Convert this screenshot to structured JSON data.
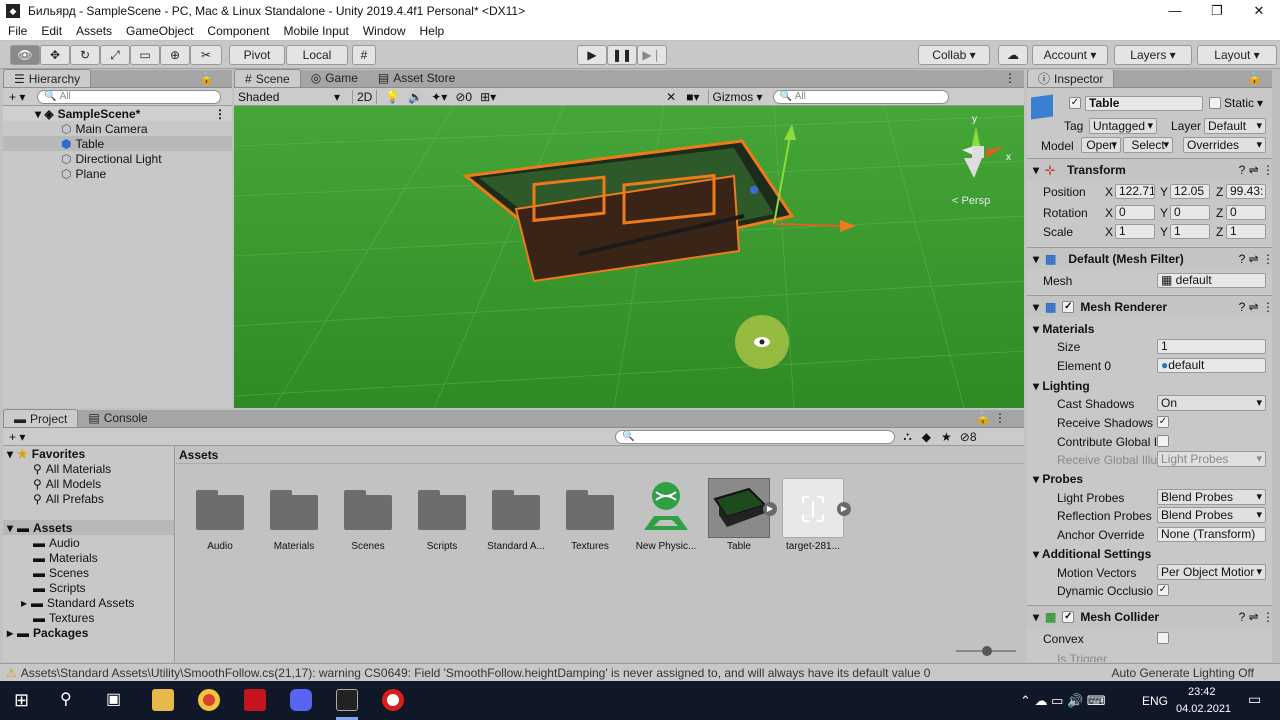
{
  "window": {
    "title": "Бильярд - SampleScene - PC, Mac & Linux Standalone - Unity 2019.4.4f1 Personal* <DX11>"
  },
  "menu": [
    "File",
    "Edit",
    "Assets",
    "GameObject",
    "Component",
    "Mobile Input",
    "Window",
    "Help"
  ],
  "toolbar": {
    "pivot": "Pivot",
    "local": "Local",
    "collab": "Collab",
    "account": "Account",
    "layers": "Layers",
    "layout": "Layout"
  },
  "hierarchy": {
    "tab": "Hierarchy",
    "search_placeholder": "All",
    "scene": "SampleScene*",
    "items": [
      "Main Camera",
      "Table",
      "Directional Light",
      "Plane"
    ]
  },
  "scene": {
    "tabs": [
      "Scene",
      "Game",
      "Asset Store"
    ],
    "shading": "Shaded",
    "mode2d": "2D",
    "hidden_count": "0",
    "gizmos": "Gizmos",
    "search_placeholder": "All",
    "persp": "< Persp",
    "axis_y": "y",
    "axis_x": "x"
  },
  "inspector": {
    "tab": "Inspector",
    "object_name": "Table",
    "static_label": "Static",
    "tag_label": "Tag",
    "tag_value": "Untagged",
    "layer_label": "Layer",
    "layer_value": "Default",
    "model_label": "Model",
    "open": "Open",
    "select": "Select",
    "overrides": "Overrides",
    "transform": {
      "title": "Transform",
      "position": "Position",
      "rotation": "Rotation",
      "scale": "Scale",
      "pos": [
        "122.71",
        "12.05",
        "99.43:"
      ],
      "rot": [
        "0",
        "0",
        "0"
      ],
      "scl": [
        "1",
        "1",
        "1"
      ],
      "axes": [
        "X",
        "Y",
        "Z"
      ]
    },
    "mesh_filter": {
      "title": "Default (Mesh Filter)",
      "mesh_label": "Mesh",
      "mesh_value": "default"
    },
    "mesh_renderer": {
      "title": "Mesh Renderer",
      "materials": "Materials",
      "size_label": "Size",
      "size_value": "1",
      "element0_label": "Element 0",
      "element0_value": "default",
      "lighting": "Lighting",
      "cast_shadows": "Cast Shadows",
      "cast_shadows_value": "On",
      "receive_shadows": "Receive Shadows",
      "contribute_gi": "Contribute Global I",
      "receive_gi": "Receive Global Illu",
      "receive_gi_value": "Light Probes",
      "probes": "Probes",
      "light_probes": "Light Probes",
      "light_probes_value": "Blend Probes",
      "reflection_probes": "Reflection Probes",
      "reflection_probes_value": "Blend Probes",
      "anchor_override": "Anchor Override",
      "anchor_override_value": "None (Transform)",
      "additional": "Additional Settings",
      "motion_vectors": "Motion Vectors",
      "motion_vectors_value": "Per Object Motior",
      "dynamic_occlusion": "Dynamic Occlusio"
    },
    "mesh_collider": {
      "title": "Mesh Collider",
      "convex": "Convex",
      "is_trigger": "Is Trigger"
    }
  },
  "project": {
    "tabs": [
      "Project",
      "Console"
    ],
    "hidden_count": "8",
    "favorites": "Favorites",
    "fav_items": [
      "All Materials",
      "All Models",
      "All Prefabs"
    ],
    "assets": "Assets",
    "asset_folders": [
      "Audio",
      "Materials",
      "Scenes",
      "Scripts",
      "Standard Assets",
      "Textures"
    ],
    "packages": "Packages",
    "breadcrumb": "Assets",
    "grid": [
      "Audio",
      "Materials",
      "Scenes",
      "Scripts",
      "Standard A...",
      "Textures",
      "New Physic...",
      "Table",
      "target-281..."
    ]
  },
  "status": {
    "message": "Assets\\Standard Assets\\Utility\\SmoothFollow.cs(21,17): warning CS0649: Field 'SmoothFollow.heightDamping' is never assigned to, and will always have its default value 0",
    "lighting": "Auto Generate Lighting Off"
  },
  "taskbar": {
    "lang": "ENG",
    "time": "23:42",
    "date": "04.02.2021"
  },
  "colors": {
    "scene_green": "#3f9a2e",
    "selection_outline": "#f07a1a",
    "hier_selected": "#b8b8b8",
    "taskbar": "#101827"
  }
}
